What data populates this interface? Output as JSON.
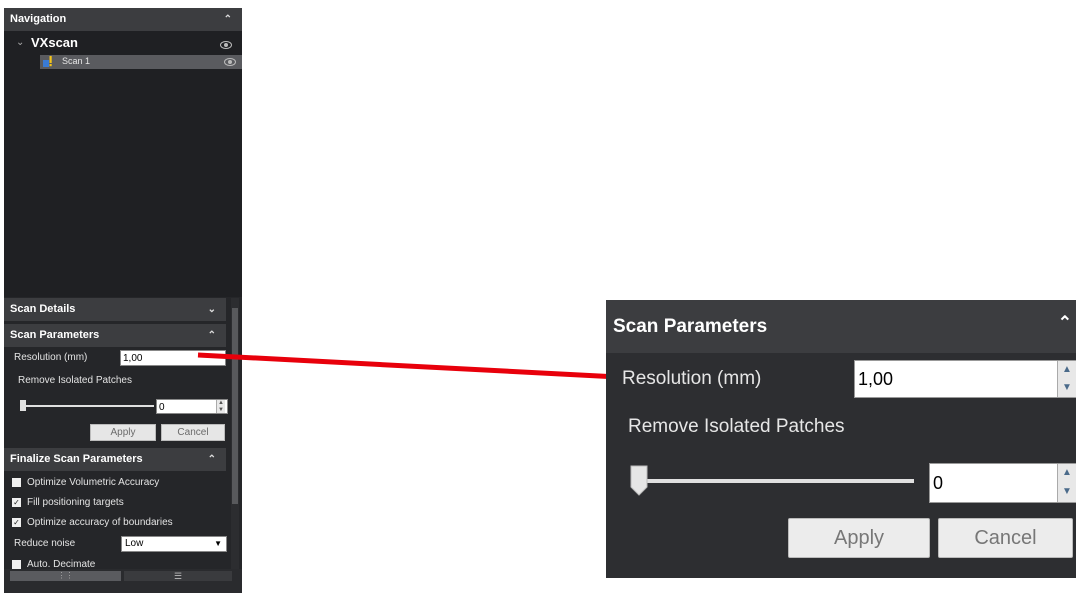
{
  "navigation": {
    "title": "Navigation",
    "collapse_icon": "chevron-up-icon",
    "tree": {
      "root_label": "VXscan",
      "child_label": "Scan 1"
    }
  },
  "scan_details": {
    "title": "Scan Details"
  },
  "scan_parameters": {
    "title": "Scan Parameters",
    "resolution_label": "Resolution (mm)",
    "resolution_value": "1,00",
    "remove_patches_label": "Remove Isolated Patches",
    "patches_value": "0",
    "apply_label": "Apply",
    "cancel_label": "Cancel"
  },
  "finalize": {
    "title": "Finalize Scan Parameters",
    "options": [
      {
        "label": "Optimize Volumetric Accuracy",
        "checked": false
      },
      {
        "label": "Fill positioning targets",
        "checked": true
      },
      {
        "label": "Optimize accuracy of boundaries",
        "checked": true
      }
    ],
    "reduce_noise_label": "Reduce noise",
    "reduce_noise_value": "Low",
    "auto_decimate_label": "Auto. Decimate"
  },
  "colors": {
    "panel_bg": "#252629",
    "header_bg": "#3c3d40",
    "connector": "#e8000b"
  }
}
